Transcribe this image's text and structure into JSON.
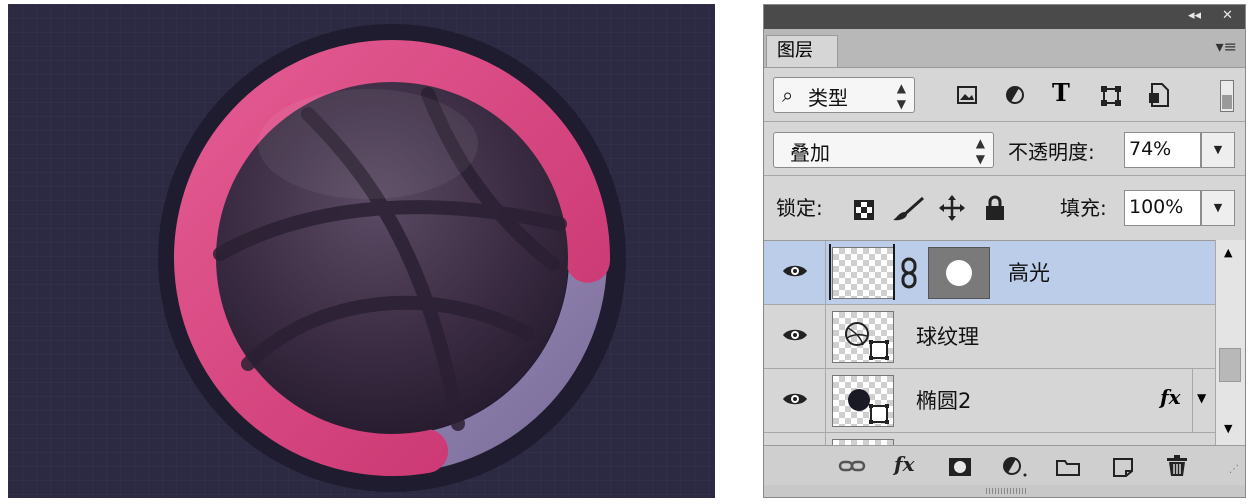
{
  "canvas": {
    "background_color": "#2c2a43",
    "progress_ring": {
      "progress_fraction": 0.78,
      "progress_color": "#e04a85",
      "track_color": "#8e7fae",
      "bezel_color": "#1e1c2e"
    },
    "ball": {
      "icon": "dribbble-ball",
      "color": "#3e2f46"
    }
  },
  "panel": {
    "title_bar": {
      "collapse_glyph": "◂◂",
      "close_glyph": "✕"
    },
    "tab_label": "图层",
    "menu_glyph": "▾≡",
    "filter": {
      "search_glyph": "⌕",
      "kind_label": "类型",
      "icons": [
        "image-filter-icon",
        "adjustment-filter-icon",
        "type-filter-icon",
        "shape-filter-icon",
        "smart-object-filter-icon"
      ]
    },
    "blend": {
      "mode": "叠加",
      "opacity_label": "不透明度:",
      "opacity_value": "74%"
    },
    "lock": {
      "lock_label": "锁定:",
      "fill_label": "填充:",
      "fill_value": "100%",
      "icons": [
        "lock-transparent-icon",
        "lock-paint-icon",
        "lock-position-icon",
        "lock-all-icon"
      ]
    },
    "layers": [
      {
        "name": "高光",
        "visible": true,
        "selected": true,
        "has_mask": true
      },
      {
        "name": "球纹理",
        "visible": true,
        "selected": false,
        "shape": true
      },
      {
        "name": "椭圆2",
        "visible": true,
        "selected": false,
        "shape": true,
        "fx": "fx"
      }
    ],
    "bottom_bar": {
      "fx_label": "fx",
      "icons": [
        "link-icon",
        "fx-icon",
        "mask-icon",
        "adjustment-icon",
        "folder-icon",
        "new-layer-icon",
        "trash-icon"
      ]
    },
    "colors": {
      "panel_bg": "#d6d6d6",
      "selected_row": "#bccde9",
      "title_bar": "#4a4a4a"
    }
  }
}
